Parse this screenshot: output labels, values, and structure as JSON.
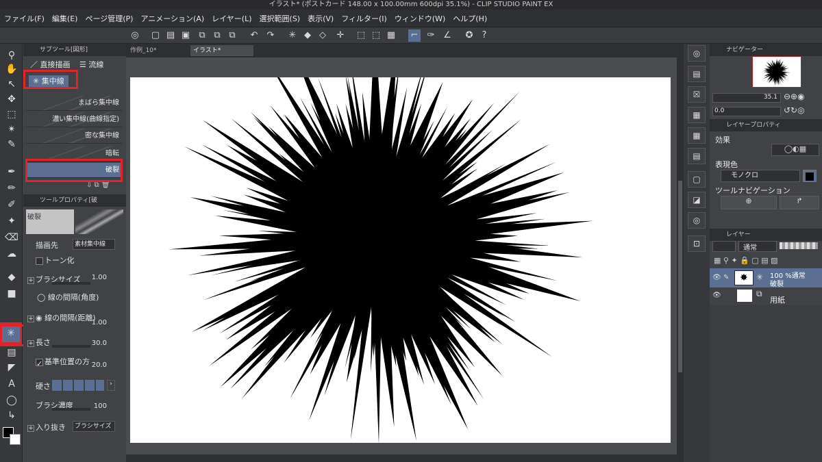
{
  "title": "イラスト* (ポストカード 148.00 x 100.00mm 600dpi 35.1%) - CLIP STUDIO PAINT EX",
  "menu": [
    "ファイル(F)",
    "編集(E)",
    "ページ管理(P)",
    "アニメーション(A)",
    "レイヤー(L)",
    "選択範囲(S)",
    "表示(V)",
    "フィルター(I)",
    "ウィンドウ(W)",
    "ヘルプ(H)"
  ],
  "subtool_panel": {
    "tab": "サブツール[図形]",
    "groups": [
      "直接描画",
      "流線",
      "集中線"
    ],
    "presets": [
      "まばら集中線",
      "濃い集中線(曲線指定)",
      "密な集中線",
      "暗転",
      "破裂"
    ]
  },
  "tool_property": {
    "tab": "ツールプロパティ[破",
    "preset_name": "破裂",
    "draw_target_label": "描画先",
    "draw_target_value": "素材集中線",
    "tone_label": "トーン化",
    "brush_size_label": "ブラシサイズ",
    "brush_size_value": "1.00",
    "line_interval_angle": "線の間隔(角度)",
    "line_interval_distance": "線の間隔(距離)",
    "line_interval_value": "1.00",
    "length_label": "長さ",
    "length_value": "30.0",
    "ref_pos_label": "基準位置の方",
    "ref_pos_value": "20.0",
    "hardness_label": "硬さ",
    "brush_density_label": "ブラシ濃度",
    "brush_density_value": "100",
    "taper_label": "入り抜き",
    "taper_value": "ブラシサイズ"
  },
  "doc_tabs": [
    "作例_10*",
    "イラスト*"
  ],
  "navigator": {
    "tab": "ナビゲーター",
    "zoom": "35.1",
    "rotation": "0.0"
  },
  "layer_property": {
    "tab": "レイヤープロパティ",
    "effect_label": "効果",
    "expression_color_label": "表現色",
    "expression_color_value": "モノクロ",
    "tool_navigation_label": "ツールナビゲーション"
  },
  "layer_panel": {
    "tab": "レイヤー",
    "blend_mode": "通常",
    "layers": [
      {
        "line1": "100 %通常",
        "line2": "破裂"
      },
      {
        "line1": "",
        "line2": "用紙"
      }
    ]
  }
}
